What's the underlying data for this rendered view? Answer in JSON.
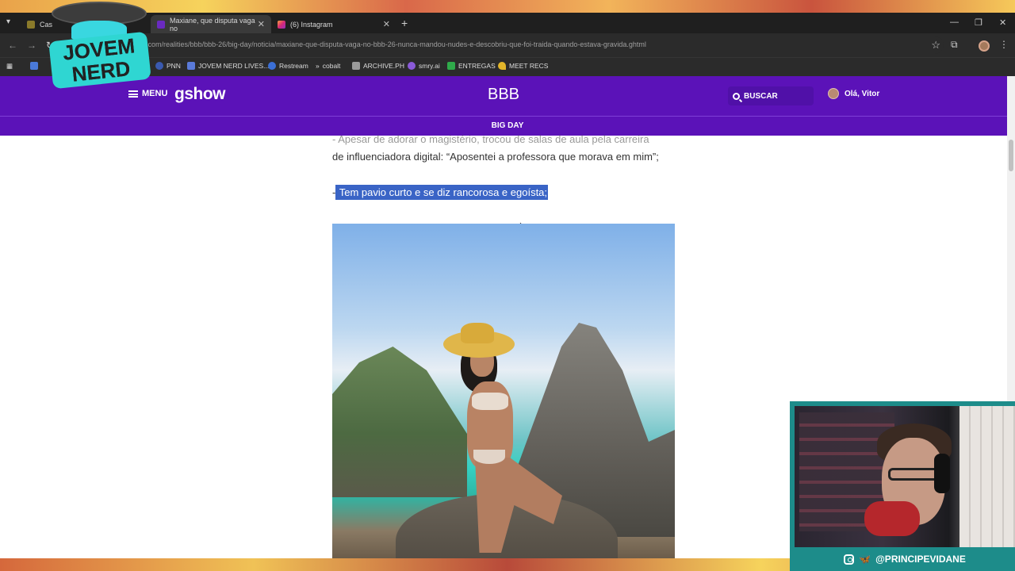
{
  "browser": {
    "tabs": [
      {
        "label": "Cas",
        "active": false
      },
      {
        "label": "Maxiane, que disputa vaga no",
        "active": true
      },
      {
        "label": "(6) Instagram",
        "active": false
      }
    ],
    "url": "gshow.globo.com/realities/bbb/bbb-26/big-day/noticia/maxiane-que-disputa-vaga-no-bbb-26-nunca-mandou-nudes-e-descobriu-que-foi-traida-quando-estava-gravida.ghtml",
    "bookmarks": [
      "PNN",
      "JOVEM NERD LIVES...",
      "Restream",
      "cobalt",
      "ARCHIVE.PH",
      "smry.ai",
      "ENTREGAS",
      "MEET RECS"
    ]
  },
  "site": {
    "menu_label": "MENU",
    "logo": "gshow",
    "section_title": "BBB",
    "search_label": "BUSCAR",
    "user_greeting": "Olá, Vitor",
    "subnav": "BIG DAY"
  },
  "article": {
    "paragraph1_faded": "- Apesar de adorar o magistério, trocou de salas de aula pela carreira",
    "paragraph1": "de influenciadora digital: “Aposentei a professora que morava em mim”;",
    "paragraph2_prefix": "-",
    "paragraph2_selected": " Tem pavio curto e se diz rancorosa e egoísta;"
  },
  "overlay": {
    "logo_text": "JOVEM NERD",
    "social_handle": "@PRINCIPEVIDANE"
  },
  "colors": {
    "gshow_purple": "#5b12b8",
    "selection_blue": "#3a64c6",
    "webcam_teal": "#1d8c8a"
  }
}
